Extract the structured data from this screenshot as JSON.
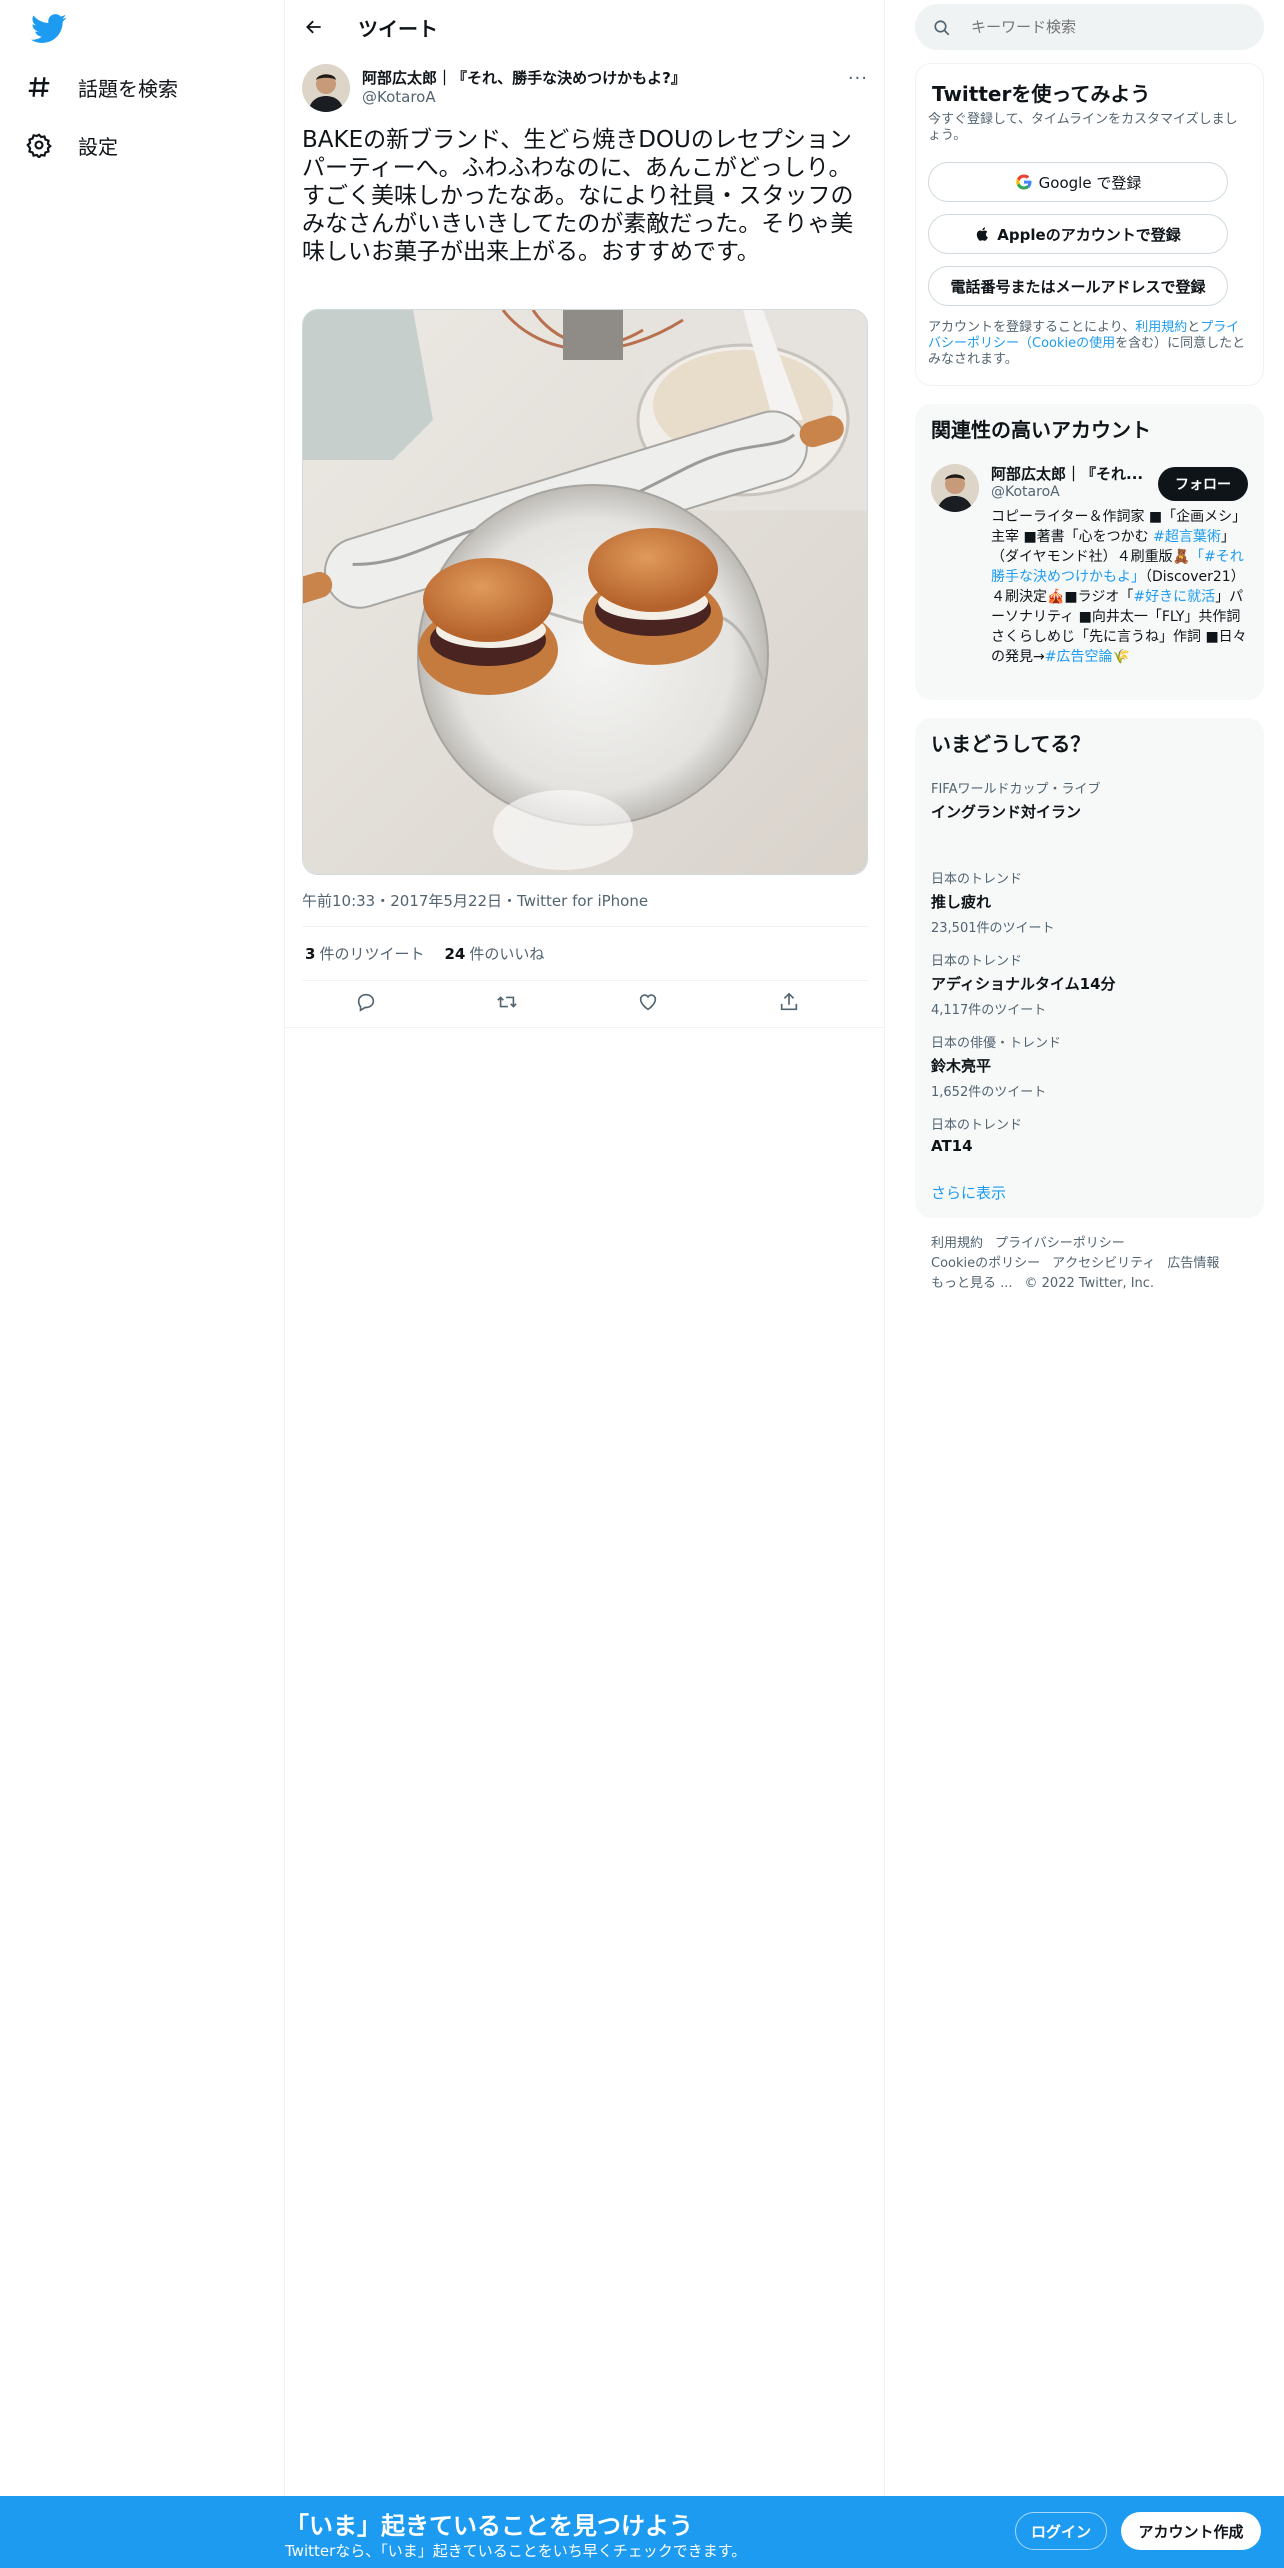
{
  "nav": {
    "logo_icon": "twitter-bird-icon",
    "items": [
      {
        "label": "話題を検索",
        "icon": "hashtag-icon"
      },
      {
        "label": "設定",
        "icon": "gear-icon"
      }
    ]
  },
  "header": {
    "title": "ツイート",
    "back_icon": "arrow-left-icon"
  },
  "tweet": {
    "author_name": "阿部広太郎｜『それ、勝手な決めつけかもよ?』",
    "author_handle": "@KotaroA",
    "more_icon": "more-icon",
    "text": "BAKEの新ブランド、生どら焼きDOUのレセプションパーティーへ。ふわふわなのに、あんこがどっしり。すごく美味しかったなあ。なにより社員・スタッフのみなさんがいきいきしてたのが素敵だった。そりゃ美味しいお菓子が出来上がる。おすすめです。",
    "meta": "午前10:33・2017年5月22日・Twitter for iPhone",
    "retweets": "3",
    "retweets_label": "件のリツイート",
    "likes": "24",
    "likes_label": "件のいいね"
  },
  "search": {
    "placeholder": "キーワード検索"
  },
  "signup": {
    "title": "Twitterを使ってみよう",
    "subtitle": "今すぐ登録して、タイムラインをカスタマイズしましょう。",
    "google": "Google で登録",
    "apple": "Appleのアカウントで登録",
    "phone": "電話番号またはメールアドレスで登録",
    "legal_1": "アカウントを登録することにより、",
    "legal_terms": "利用規約",
    "legal_2": "と",
    "legal_privacy": "プライバシーポリシー（Cookieの使用",
    "legal_3": "を含む）に同意したとみなされます。"
  },
  "related": {
    "title": "関連性の高いアカウント",
    "name": "阿部広太郎｜『それ...",
    "handle": "@KotaroA",
    "follow": "フォロー",
    "bio_a": "コピーライター＆作詞家 ■「企画メシ」主宰 ■著書「心をつかむ ",
    "bio_tag1": "#超言葉術",
    "bio_b": "」（ダイヤモンド社）４刷重版🧸",
    "bio_tag2": "「#それ勝手な決めつけかもよ」",
    "bio_c": "（Discover21）４刷決定🎪■ラジオ「",
    "bio_tag3": "#好きに就活",
    "bio_d": "」パーソナリティ ■向井太一「FLY」共作詞 さくらしめじ「先に言うね」作詞 ■日々の発見→",
    "bio_tag4": "#広告空論",
    "bio_e": "🌾"
  },
  "trends": {
    "title": "いまどうしてる？",
    "items": [
      {
        "category": "FIFAワールドカップ・ライブ",
        "name": "イングランド対イラン",
        "count": ""
      },
      {
        "category": "日本のトレンド",
        "name": "推し疲れ",
        "count": "23,501件のツイート"
      },
      {
        "category": "日本のトレンド",
        "name": "アディショナルタイム14分",
        "count": "4,117件のツイート"
      },
      {
        "category": "日本の俳優・トレンド",
        "name": "鈴木亮平",
        "count": "1,652件のツイート"
      },
      {
        "category": "日本のトレンド",
        "name": "AT14",
        "count": ""
      }
    ],
    "show_more": "さらに表示"
  },
  "footer": {
    "terms": "利用規約",
    "privacy": "プライバシーポリシー",
    "cookie": "Cookieのポリシー",
    "accessibility": "アクセシビリティ",
    "ads": "広告情報",
    "more": "もっと見る ...",
    "copyright": "© 2022 Twitter, Inc."
  },
  "banner": {
    "title": "「いま」起きていることを見つけよう",
    "subtitle": "Twitterなら、「いま」起きていることをいち早くチェックできます。",
    "login": "ログイン",
    "signup": "アカウント作成"
  },
  "colors": {
    "accent": "#1d9bf0",
    "text": "#0f1419",
    "muted": "#536471"
  }
}
